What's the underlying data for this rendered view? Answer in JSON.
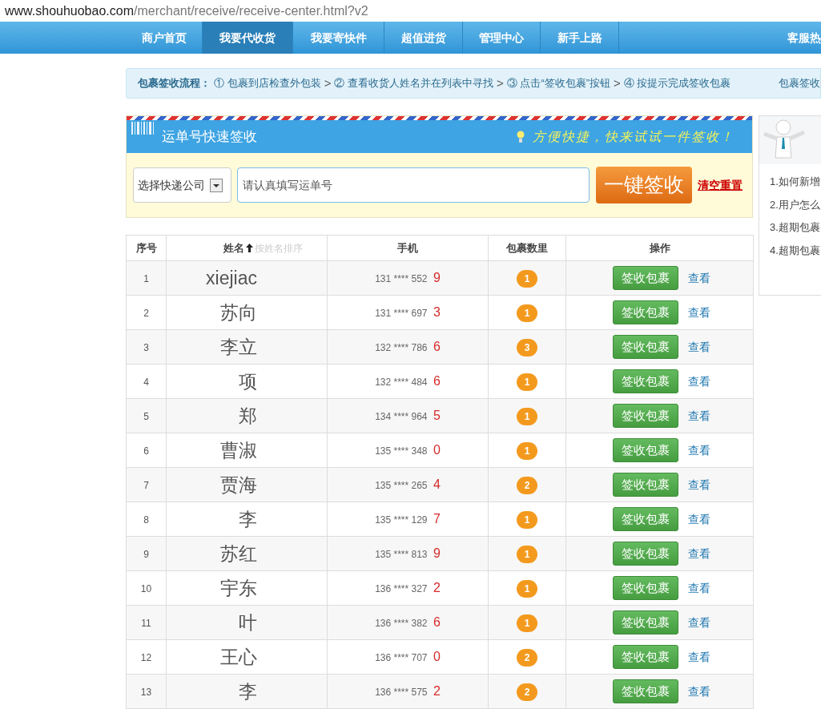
{
  "address_bar": {
    "host": "www.shouhuobao.com",
    "path": "/merchant/receive/receive-center.html?v2"
  },
  "nav": {
    "items": [
      {
        "label": "商户首页",
        "selected": false
      },
      {
        "label": "我要代收货",
        "selected": true
      },
      {
        "label": "我要寄快件",
        "selected": false
      },
      {
        "label": "超值进货",
        "selected": false
      },
      {
        "label": "管理中心",
        "selected": false
      },
      {
        "label": "新手上路",
        "selected": false
      }
    ],
    "right": "客服热"
  },
  "flow": {
    "title": "包裹签收流程：",
    "steps": [
      "① 包裹到店检查外包装",
      "② 查看收货人姓名并在列表中寻找",
      "③ 点击“签收包裹”按钮",
      "④ 按提示完成签收包裹"
    ],
    "separator": ">",
    "right_link": "包裹签收"
  },
  "quick_sign": {
    "title": "运单号快速签收",
    "slogan": "方便快捷，快来试试一件签收！",
    "company_select": "选择快递公司",
    "waybill_placeholder": "请认真填写运单号",
    "submit": "一键签收",
    "reset": "清空重置"
  },
  "table": {
    "columns": [
      "序号",
      "姓名",
      "手机",
      "包裹数里",
      "操作"
    ],
    "sort_hint": "按姓名排序",
    "rows": [
      {
        "no": "1",
        "name": "xiejiac",
        "phone": "131 **** 552",
        "last_digit": "9",
        "count": "1",
        "sign_button": "签收包裹",
        "view_link": "查看"
      },
      {
        "no": "2",
        "name": "苏向",
        "phone": "131 **** 697",
        "last_digit": "3",
        "count": "1",
        "sign_button": "签收包裹",
        "view_link": "查看"
      },
      {
        "no": "3",
        "name": "李立",
        "phone": "132 **** 786",
        "last_digit": "6",
        "count": "3",
        "sign_button": "签收包裹",
        "view_link": "查看"
      },
      {
        "no": "4",
        "name": "项",
        "phone": "132 **** 484",
        "last_digit": "6",
        "count": "1",
        "sign_button": "签收包裹",
        "view_link": "查看"
      },
      {
        "no": "5",
        "name": "郑",
        "phone": "134 **** 964",
        "last_digit": "5",
        "count": "1",
        "sign_button": "签收包裹",
        "view_link": "查看"
      },
      {
        "no": "6",
        "name": "曹淑",
        "phone": "135 **** 348",
        "last_digit": "0",
        "count": "1",
        "sign_button": "签收包裹",
        "view_link": "查看"
      },
      {
        "no": "7",
        "name": "贾海",
        "phone": "135 **** 265",
        "last_digit": "4",
        "count": "2",
        "sign_button": "签收包裹",
        "view_link": "查看"
      },
      {
        "no": "8",
        "name": "李",
        "phone": "135 **** 129",
        "last_digit": "7",
        "count": "1",
        "sign_button": "签收包裹",
        "view_link": "查看"
      },
      {
        "no": "9",
        "name": "苏红",
        "phone": "135 **** 813",
        "last_digit": "9",
        "count": "1",
        "sign_button": "签收包裹",
        "view_link": "查看"
      },
      {
        "no": "10",
        "name": "宇东",
        "phone": "136 **** 327",
        "last_digit": "2",
        "count": "1",
        "sign_button": "签收包裹",
        "view_link": "查看"
      },
      {
        "no": "11",
        "name": "叶",
        "phone": "136 **** 382",
        "last_digit": "6",
        "count": "1",
        "sign_button": "签收包裹",
        "view_link": "查看"
      },
      {
        "no": "12",
        "name": "王心",
        "phone": "136 **** 707",
        "last_digit": "0",
        "count": "2",
        "sign_button": "签收包裹",
        "view_link": "查看"
      },
      {
        "no": "13",
        "name": "李",
        "phone": "136 **** 575",
        "last_digit": "2",
        "count": "2",
        "sign_button": "签收包裹",
        "view_link": "查看"
      }
    ]
  },
  "help": {
    "items": [
      "1.如何新增",
      "2.用户怎么",
      "3.超期包裹",
      "4.超期包裹"
    ]
  }
}
